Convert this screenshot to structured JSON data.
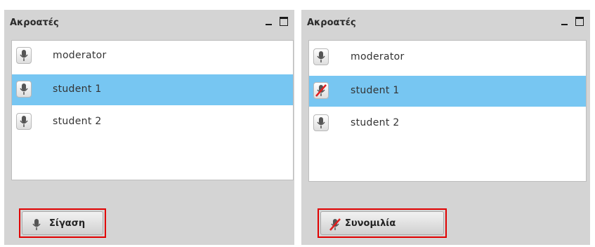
{
  "left_panel": {
    "title": "Ακροατές",
    "rows": [
      {
        "label": "moderator",
        "icon": "microphone-icon",
        "selected": false
      },
      {
        "label": "student 1",
        "icon": "microphone-icon",
        "selected": true
      },
      {
        "label": "student 2",
        "icon": "microphone-icon",
        "selected": false
      }
    ],
    "action_label": "Σίγαση",
    "action_icon": "microphone-icon"
  },
  "right_panel": {
    "title": "Ακροατές",
    "rows": [
      {
        "label": "moderator",
        "icon": "microphone-icon",
        "selected": false
      },
      {
        "label": "student 1",
        "icon": "microphone-muted-icon",
        "selected": true
      },
      {
        "label": "student 2",
        "icon": "microphone-icon",
        "selected": false
      }
    ],
    "action_label": "Συνομιλία",
    "action_icon": "microphone-muted-icon"
  },
  "colors": {
    "panel_bg": "#d4d4d4",
    "selected_row": "#77c6f2",
    "highlight_border": "#e00000",
    "mute_slash": "#e02020"
  }
}
